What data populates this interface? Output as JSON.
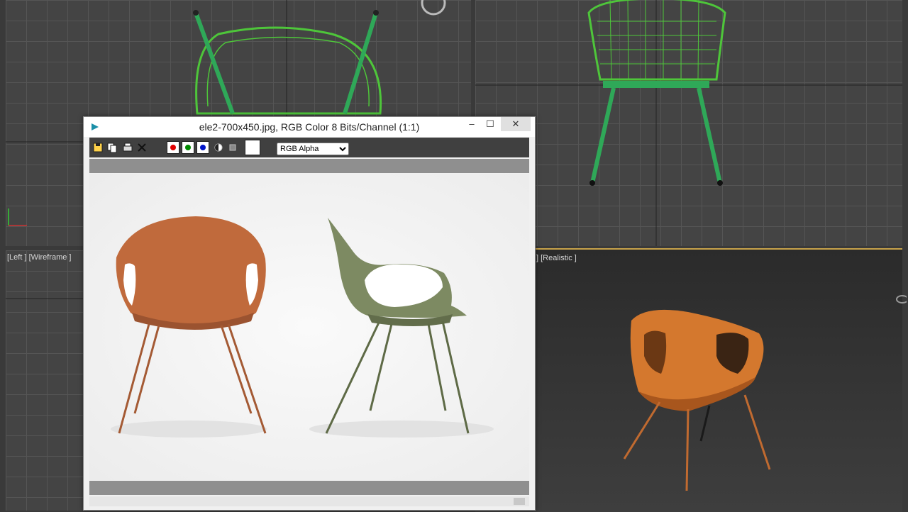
{
  "viewports": {
    "top_left": {
      "label": ""
    },
    "front": {
      "label": ""
    },
    "left": {
      "label": "[Left ] [Wireframe ]"
    },
    "perspective": {
      "label": "] [Realistic ]"
    }
  },
  "window": {
    "title": "ele2-700x450.jpg, RGB Color 8 Bits/Channel (1:1)",
    "minimize": "–",
    "maximize": "☐",
    "close": "✕"
  },
  "toolbar": {
    "icons": [
      "save-icon",
      "copy-icon",
      "print-icon",
      "clear-icon"
    ],
    "channels": [
      {
        "name": "red-channel",
        "color": "#e00000"
      },
      {
        "name": "green-channel",
        "color": "#008a00"
      },
      {
        "name": "blue-channel",
        "color": "#0014c8"
      }
    ],
    "channel_select": {
      "value": "RGB Alpha",
      "options": [
        "RGB Alpha"
      ]
    }
  },
  "colors": {
    "wire_green": "#4ec63a",
    "chair_orange": "#c06a3c",
    "chair_olive": "#7d8a62",
    "render_orange": "#d4782e"
  }
}
